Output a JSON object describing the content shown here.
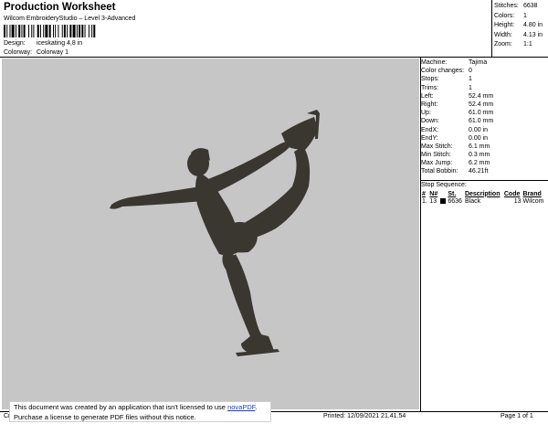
{
  "header": {
    "title": "Production Worksheet",
    "subtitle": "Wilcom EmbroideryStudio – Level 3-Advanced",
    "design_label": "Design:",
    "design_value": "iceskating 4,8 in",
    "colorway_label": "Colorway:",
    "colorway_value": "Colorway 1"
  },
  "summary": [
    {
      "label": "Stitches:",
      "value": "6638"
    },
    {
      "label": "Colors:",
      "value": "1"
    },
    {
      "label": "Height:",
      "value": "4.80 in"
    },
    {
      "label": "Width:",
      "value": "4.13 in"
    },
    {
      "label": "Zoom:",
      "value": "1:1"
    }
  ],
  "machine_info": [
    {
      "label": "Machine:",
      "value": "Tajima"
    },
    {
      "label": "Color changes:",
      "value": "0"
    },
    {
      "label": "Stops:",
      "value": "1"
    },
    {
      "label": "Trims:",
      "value": "1"
    },
    {
      "label": "Left:",
      "value": "52.4 mm"
    },
    {
      "label": "Right:",
      "value": "52.4 mm"
    },
    {
      "label": "Up:",
      "value": "61.0 mm"
    },
    {
      "label": "Down:",
      "value": "61.0 mm"
    },
    {
      "label": "EndX:",
      "value": "0.00 in"
    },
    {
      "label": "EndY:",
      "value": "0.00 in"
    },
    {
      "label": "Max Stitch:",
      "value": "6.1 mm"
    },
    {
      "label": "Min Stitch:",
      "value": "0.3 mm"
    },
    {
      "label": "Max Jump:",
      "value": "6.2 mm"
    },
    {
      "label": "Total Bobbin:",
      "value": "46.21ft"
    }
  ],
  "stop_sequence": {
    "title": "Stop Sequence:",
    "headers": [
      "#",
      "N#",
      "",
      "St.",
      "Description",
      "Code",
      "Brand"
    ],
    "rows": [
      {
        "num": "1.",
        "n": "13",
        "color": "#000000",
        "stitches": "6636",
        "description": "Black",
        "code": "13",
        "brand": "Wilcom"
      }
    ]
  },
  "footer": {
    "left": "Cr",
    "printed": "Printed: 12/09/2021 21.41.54",
    "page": "Page 1 of 1"
  },
  "notice": {
    "line1_pre": "This document was created by an application that isn't licensed to use ",
    "link": "novaPDF",
    "line1_post": ".",
    "line2": "Purchase a license to generate PDF files without this notice."
  },
  "design_preview": {
    "fill_color": "#3a3630",
    "icon": "figure-skater-silhouette"
  }
}
